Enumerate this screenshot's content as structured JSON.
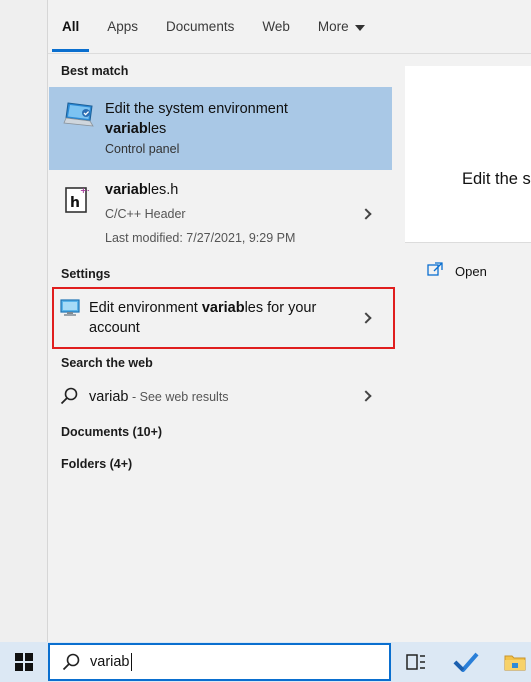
{
  "tabs": [
    {
      "label": "All"
    },
    {
      "label": "Apps"
    },
    {
      "label": "Documents"
    },
    {
      "label": "Web"
    },
    {
      "label": "More"
    }
  ],
  "sections": {
    "best_match": "Best match",
    "settings": "Settings",
    "search_web": "Search the web",
    "documents": "Documents (10+)",
    "folders": "Folders (4+)"
  },
  "best_match": {
    "title_pre": "Edit the system environment",
    "title_bold": "variab",
    "title_post": "les",
    "subtitle": "Control panel"
  },
  "file_result": {
    "name_bold": "variab",
    "name_rest": "les.h",
    "type": "C/C++ Header",
    "modified": "Last modified: 7/27/2021, 9:29 PM"
  },
  "setting_result": {
    "pre": "Edit environment ",
    "bold": "variab",
    "post": "les for your",
    "line2": "account"
  },
  "web_result": {
    "query": "variab",
    "suffix": " - See web results"
  },
  "preview": {
    "title": "Edit the s",
    "open_label": "Open"
  },
  "taskbar": {
    "search_value": "variab"
  },
  "colors": {
    "selected_bg": "#a9c8e6",
    "accent": "#0a6fcf",
    "highlight_border": "#e01e1e"
  }
}
